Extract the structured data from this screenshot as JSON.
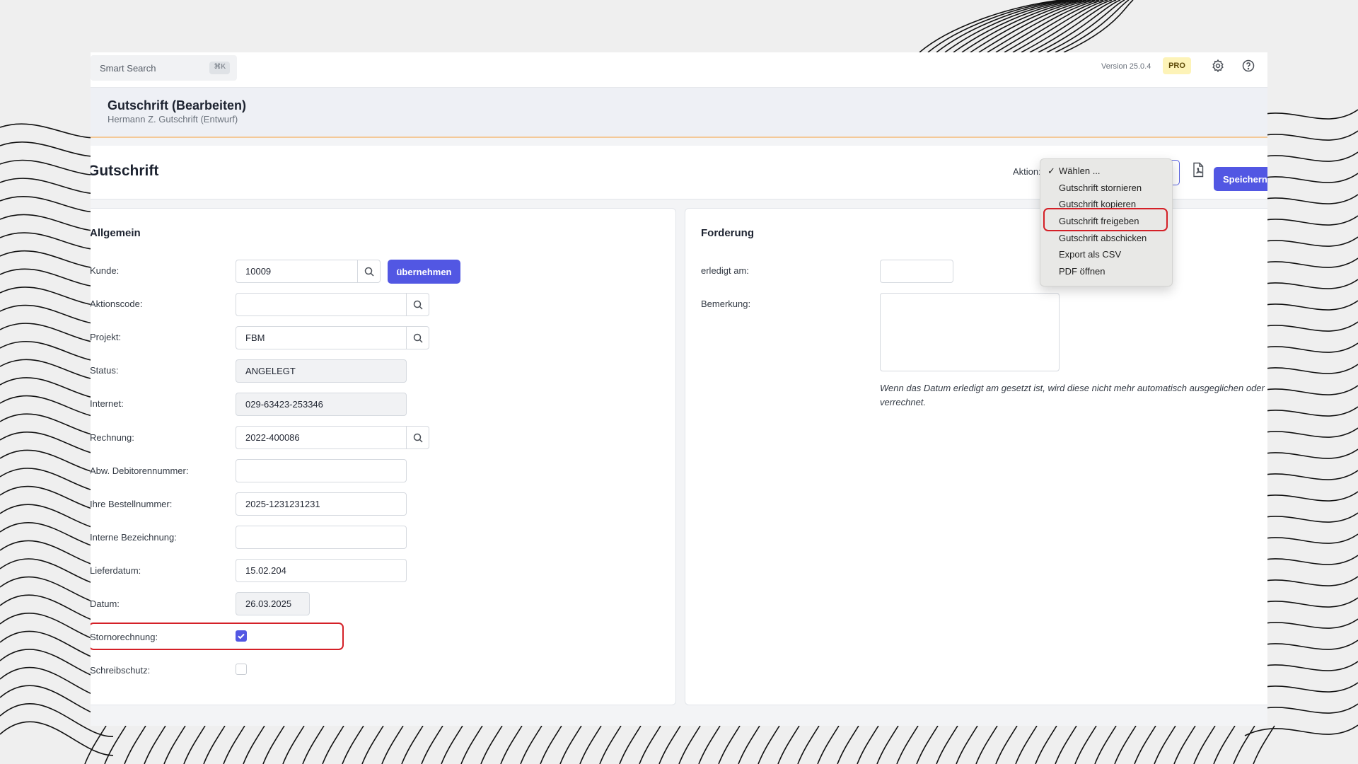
{
  "topbar": {
    "search_placeholder": "Smart Search",
    "search_shortcut": "⌘K",
    "version": "Version 25.0.4",
    "plan_badge": "PRO",
    "settings_icon": "gear-icon",
    "help_icon": "help-icon"
  },
  "header": {
    "title": "Gutschrift (Bearbeiten)",
    "subtitle": "Hermann Z. Gutschrift (Entwurf)"
  },
  "toolbar": {
    "page_title": "Gutschrift",
    "aktion_label": "Aktion:",
    "pdf_icon": "pdf-icon",
    "save_label": "Speichern"
  },
  "aktion_menu": {
    "selected": "Wählen ...",
    "items": [
      "Wählen ...",
      "Gutschrift stornieren",
      "Gutschrift kopieren",
      "Gutschrift freigeben",
      "Gutschrift abschicken",
      "Export als CSV",
      "PDF öffnen"
    ],
    "highlighted_item": "Gutschrift freigeben"
  },
  "allgemein": {
    "title": "Allgemein",
    "kunde": {
      "label": "Kunde:",
      "value": "10009",
      "button": "übernehmen"
    },
    "aktionscode": {
      "label": "Aktionscode:",
      "value": ""
    },
    "projekt": {
      "label": "Projekt:",
      "value": "FBM"
    },
    "status": {
      "label": "Status:",
      "value": "ANGELEGT"
    },
    "internet": {
      "label": "Internet:",
      "value": "029-63423-253346"
    },
    "rechnung": {
      "label": "Rechnung:",
      "value": "2022-400086"
    },
    "abw_debitor": {
      "label": "Abw. Debitorennummer:",
      "value": ""
    },
    "bestellnummer": {
      "label": "Ihre Bestellnummer:",
      "value": "2025-1231231231"
    },
    "interne_bezeichnung": {
      "label": "Interne Bezeichnung:",
      "value": ""
    },
    "lieferdatum": {
      "label": "Lieferdatum:",
      "value": "15.02.204"
    },
    "datum": {
      "label": "Datum:",
      "value": "26.03.2025"
    },
    "stornorechnung": {
      "label": "Stornorechnung:",
      "checked": true
    },
    "schreibschutz": {
      "label": "Schreibschutz:",
      "checked": false
    }
  },
  "forderung": {
    "title": "Forderung",
    "erledigt_am": {
      "label": "erledigt am:",
      "value": ""
    },
    "bemerkung": {
      "label": "Bemerkung:",
      "value": ""
    },
    "hint": "Wenn das Datum erledigt am gesetzt ist, wird diese nicht mehr automatisch ausgeglichen oder verrechnet."
  },
  "colors": {
    "accent": "#5257e3",
    "highlight": "#d42027",
    "badge": "#fdf3b8"
  }
}
